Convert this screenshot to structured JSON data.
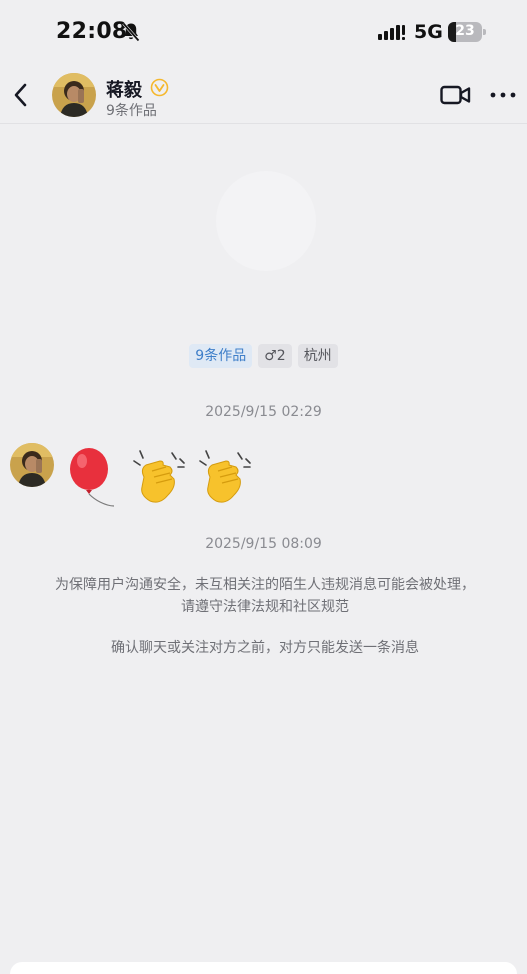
{
  "status_bar": {
    "time": "22:08",
    "network": "5G",
    "battery": "23",
    "battery_level": 0.23,
    "icons": [
      "bell-muted-icon",
      "signal-icon",
      "battery-icon"
    ]
  },
  "header": {
    "name": "蒋毅",
    "subtitle": "9条作品",
    "icons": [
      "back-icon",
      "verified-icon",
      "video-call-icon",
      "more-icon"
    ],
    "verified_color": "#f5b82e"
  },
  "profile": {
    "tags": [
      {
        "label": "9条作品",
        "kind": "works"
      },
      {
        "label": "♂2",
        "kind": "gender"
      },
      {
        "label": "杭州",
        "kind": "location"
      }
    ]
  },
  "messages": [
    {
      "timestamp": "2025/9/15 02:29",
      "content_emoji": [
        "balloon-emoji",
        "clapping-hands-emoji",
        "clapping-hands-emoji"
      ]
    }
  ],
  "second_timestamp": "2025/9/15 08:09",
  "notices": [
    "为保障用户沟通安全，未互相关注的陌生人违规消息可能会被处理，请遵守法律法规和社区规范",
    "确认聊天或关注对方之前，对方只能发送一条消息"
  ],
  "colors": {
    "background": "#efeff1",
    "accent_blue": "#3f7fc9",
    "muted_text": "#6f7076"
  }
}
